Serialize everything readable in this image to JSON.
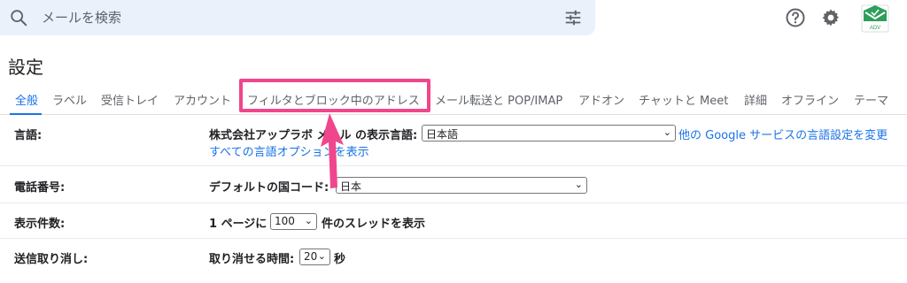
{
  "search": {
    "placeholder": "メールを検索"
  },
  "avatar_text": "ADV",
  "page_title": "設定",
  "tabs": [
    {
      "label": "全般"
    },
    {
      "label": "ラベル"
    },
    {
      "label": "受信トレイ"
    },
    {
      "label": "アカウント"
    },
    {
      "label": "フィルタとブロック中のアドレス"
    },
    {
      "label": "メール転送と POP/IMAP"
    },
    {
      "label": "アドオン"
    },
    {
      "label": "チャットと Meet"
    },
    {
      "label": "詳細"
    },
    {
      "label": "オフライン"
    },
    {
      "label": "テーマ"
    }
  ],
  "rows": {
    "language": {
      "label": "言語:",
      "prefix": "株式会社アップラボ メール の表示言語:",
      "select_value": "日本語",
      "link_other": "他の Google サービスの言語設定を変更",
      "link_all": "すべての言語オプションを表示"
    },
    "phone": {
      "label": "電話番号:",
      "prefix": "デフォルトの国コード:",
      "select_value": "日本"
    },
    "page_size": {
      "label": "表示件数:",
      "prefix": "1 ページに",
      "select_value": "100",
      "suffix": "件のスレッドを表示"
    },
    "undo_send": {
      "label": "送信取り消し:",
      "prefix": "取り消せる時間:",
      "select_value": "20",
      "suffix": "秒"
    }
  },
  "colors": {
    "accent": "#1a73e8",
    "highlight": "#f0468c"
  }
}
